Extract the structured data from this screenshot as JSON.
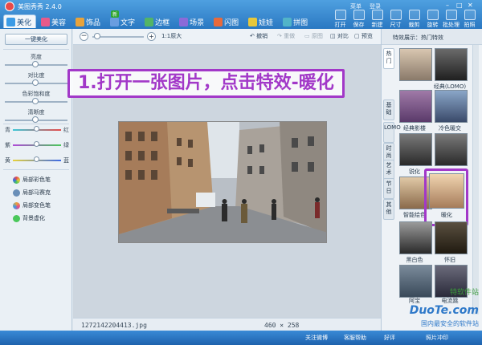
{
  "app": {
    "title": "美图秀秀 2.4.0"
  },
  "window": {
    "menu": "菜单",
    "login": "登录"
  },
  "tabs": [
    {
      "label": "美化",
      "color": "#3b9be6"
    },
    {
      "label": "美容",
      "color": "#e85a8a"
    },
    {
      "label": "饰品",
      "color": "#e8a33b"
    },
    {
      "label": "文字",
      "color": "#6a9de0"
    },
    {
      "label": "边框",
      "color": "#53b466"
    },
    {
      "label": "场景",
      "color": "#8b6ad8"
    },
    {
      "label": "闪图",
      "color": "#e86a3b"
    },
    {
      "label": "娃娃",
      "color": "#e8c83b"
    },
    {
      "label": "拼图",
      "color": "#52b4c8"
    }
  ],
  "tab_new_badge": "新",
  "toolbar": {
    "open": "打开",
    "save": "保存",
    "new": "新建",
    "size": "尺寸",
    "crop": "裁剪",
    "rotate": "旋转",
    "batch": "批处理",
    "camera": "拍照"
  },
  "left": {
    "one_key": "一键美化",
    "brightness": "亮度",
    "contrast": "对比度",
    "saturation": "色彩饱和度",
    "sharpness": "清晰度",
    "color_rows": [
      {
        "left": "青",
        "right": "红"
      },
      {
        "left": "紫",
        "right": "绿"
      },
      {
        "left": "黄",
        "right": "蓝"
      }
    ],
    "brushes": [
      "局部彩色笔",
      "局部马赛克",
      "局部变色笔",
      "背景虚化"
    ]
  },
  "center": {
    "zoom_ratio": "1:1原大",
    "undo": "撤销",
    "redo": "重做",
    "restore": "原图",
    "compare": "对比",
    "preview": "预览"
  },
  "status": {
    "filename": "1272142204413.jpg",
    "dimensions": "460 × 258"
  },
  "right": {
    "header": "特效展示：热门特效",
    "vtabs": [
      "热门",
      "基础",
      "LOMO",
      "时尚",
      "艺术",
      "节日",
      "其他"
    ],
    "effects": [
      "经典(LOMO)",
      "经典影楼",
      "冷色暖交",
      "锐化",
      "暖化",
      "智能绘色",
      "黑白色",
      "怀旧",
      "阿宝",
      "电流跳"
    ]
  },
  "banner": "1.打开一张图片，点击特效-暖化",
  "watermark": {
    "brand": "DuoTe.com",
    "sub": "国内最安全的软件站",
    "site": "特软件站"
  },
  "bottom": {
    "weibo": "关注微博",
    "help": "客服帮助",
    "like": "好评",
    "photo": "照片冲印"
  }
}
